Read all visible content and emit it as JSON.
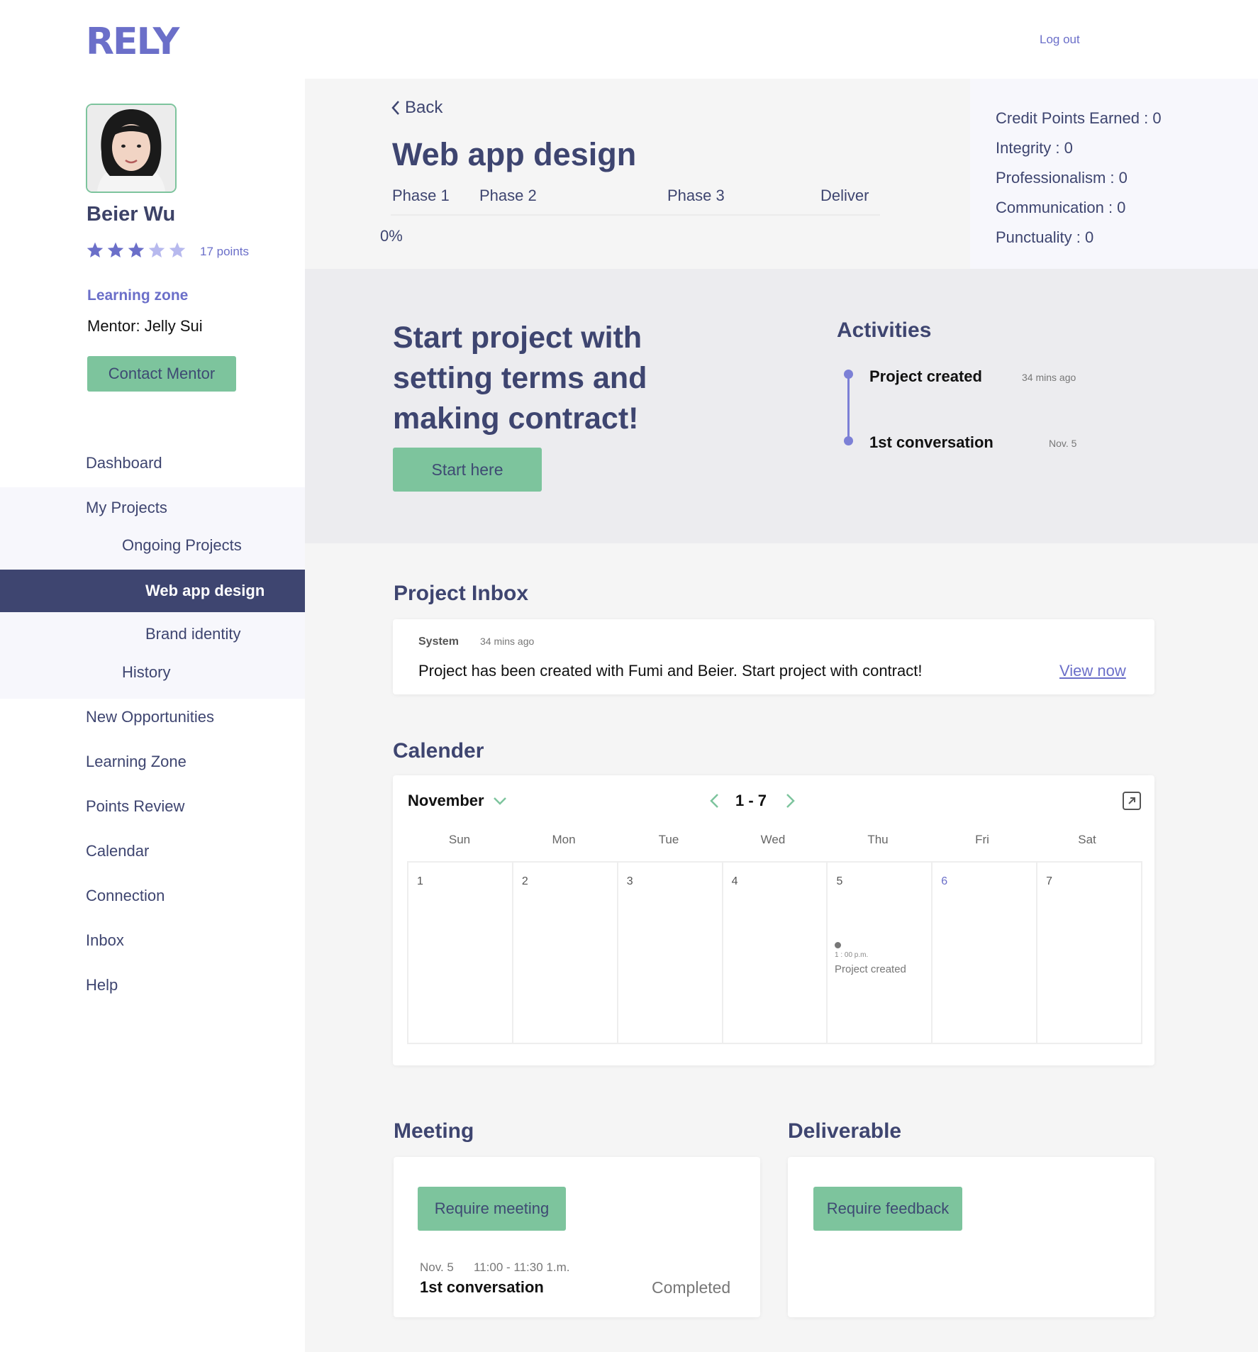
{
  "brand": {
    "logo_text": "RELY",
    "accent": "#6b6fc9",
    "navy": "#3e4570",
    "green": "#7dc49d"
  },
  "header": {
    "logout": "Log out"
  },
  "profile": {
    "name": "Beier Wu",
    "rating": 3,
    "rating_max": 5,
    "points": "17 points",
    "learning_zone": "Learning zone",
    "mentor": "Mentor: Jelly Sui",
    "contact_button": "Contact Mentor"
  },
  "nav": {
    "dashboard": "Dashboard",
    "my_projects": "My Projects",
    "ongoing_projects": "Ongoing Projects",
    "web_app_design": "Web app design",
    "brand_identity": "Brand identity",
    "history": "History",
    "new_opportunities": "New Opportunities",
    "learning_zone": "Learning Zone",
    "points_review": "Points Review",
    "calendar": "Calendar",
    "connection": "Connection",
    "inbox": "Inbox",
    "help": "Help"
  },
  "project": {
    "back": "Back",
    "title": "Web app design",
    "phases": [
      "Phase 1",
      "Phase 2",
      "Phase 3",
      "Deliver"
    ],
    "progress": "0%"
  },
  "stats": [
    "Credit Points Earned : 0",
    "Integrity : 0",
    "Professionalism : 0",
    "Communication : 0",
    "Punctuality : 0"
  ],
  "hero": {
    "text": "Start project with setting terms and making contract!",
    "button": "Start here"
  },
  "activities": {
    "title": "Activities",
    "items": [
      {
        "label": "Project created",
        "time": "34 mins ago"
      },
      {
        "label": "1st conversation",
        "time": "Nov. 5"
      }
    ]
  },
  "inbox": {
    "title": "Project Inbox",
    "sender": "System",
    "time": "34 mins ago",
    "message": "Project has been created with Fumi and Beier. Start project with contract!",
    "link": "View now"
  },
  "calendar": {
    "title": "Calender",
    "month": "November",
    "range": "1 - 7",
    "days": [
      "Sun",
      "Mon",
      "Tue",
      "Wed",
      "Thu",
      "Fri",
      "Sat"
    ],
    "dates": [
      "1",
      "2",
      "3",
      "4",
      "5",
      "6",
      "7"
    ],
    "event_time": "1 : 00 p.m.",
    "event_label": "Project created"
  },
  "meeting": {
    "title": "Meeting",
    "button": "Require meeting",
    "date": "Nov. 5",
    "hours": "11:00 - 11:30 1.m.",
    "name": "1st conversation",
    "status": "Completed"
  },
  "deliverable": {
    "title": "Deliverable",
    "button": "Require feedback"
  }
}
